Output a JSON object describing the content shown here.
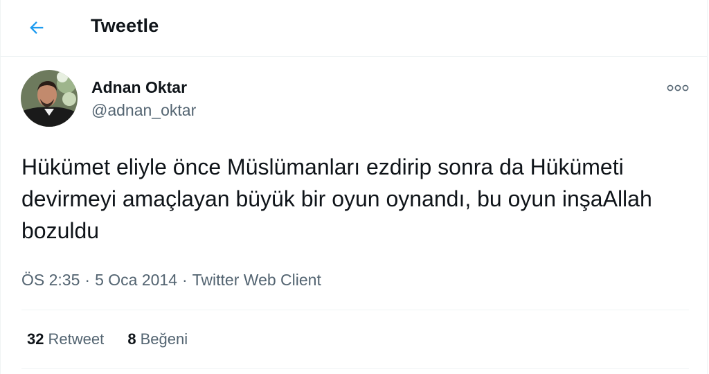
{
  "header": {
    "title": "Tweetle",
    "back_icon": "arrow-left-icon"
  },
  "colors": {
    "accent": "#1d9bf0",
    "text_primary": "#0f1419",
    "text_secondary": "#536471",
    "divider": "#eff3f4"
  },
  "tweet": {
    "author": {
      "display_name": "Adnan Oktar",
      "handle": "@adnan_oktar"
    },
    "more_icon": "more-dots-icon",
    "text": "Hükümet eliyle önce Müslümanları ezdirip sonra da Hükümeti devirmeyi amaçlayan büyük bir oyun oynandı, bu oyun inşaAllah bozuldu",
    "meta": {
      "time": "ÖS 2:35",
      "separator": "·",
      "date": "5 Oca 2014",
      "source": "Twitter Web Client"
    },
    "stats": {
      "retweets": {
        "count": "32",
        "label": "Retweet"
      },
      "likes": {
        "count": "8",
        "label": "Beğeni"
      }
    }
  }
}
